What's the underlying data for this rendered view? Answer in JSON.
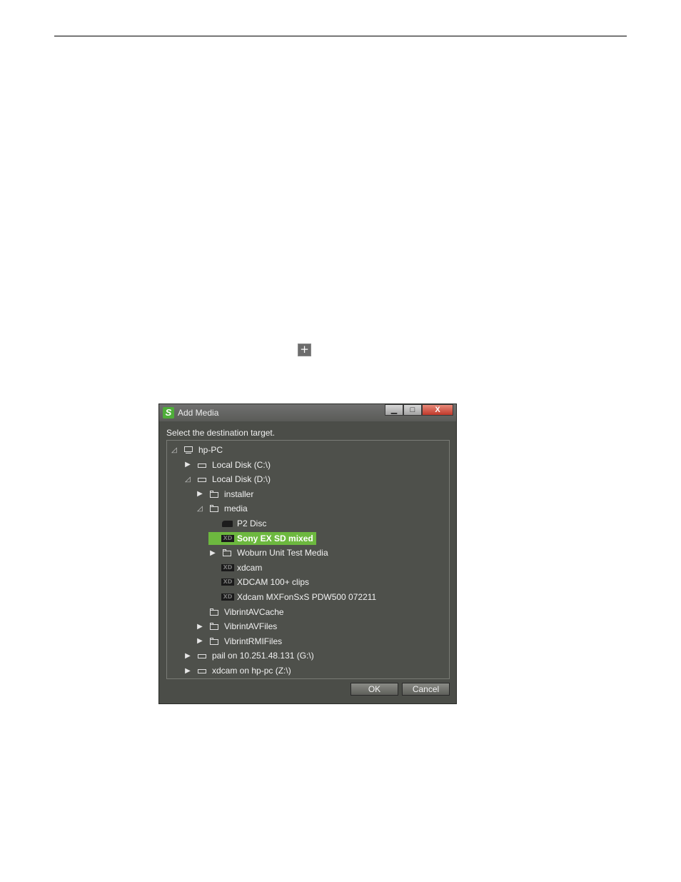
{
  "page": {
    "plus_icon": "+"
  },
  "dialog": {
    "title": "Add Media",
    "app_icon": "S",
    "window_buttons": {
      "minimize": "▁",
      "maximize": "□",
      "close": "X"
    },
    "instruction": "Select the destination target.",
    "tree": [
      {
        "label": "hp-PC",
        "icon": "computer-icon",
        "expander": "◿",
        "level": 0
      },
      {
        "label": "Local Disk (C:\\)",
        "icon": "drive-icon",
        "expander": "▶",
        "level": 1
      },
      {
        "label": "Local Disk (D:\\)",
        "icon": "drive-icon",
        "expander": "◿",
        "level": 1
      },
      {
        "label": "installer",
        "icon": "folder-icon",
        "expander": "▶",
        "level": 2
      },
      {
        "label": "media",
        "icon": "folder-icon",
        "expander": "◿",
        "level": 2
      },
      {
        "label": "P2 Disc",
        "icon": "p2-icon",
        "expander": "",
        "level": 3
      },
      {
        "label": "Sony EX SD mixed",
        "icon": "xd-icon",
        "expander": "",
        "level": 3,
        "selected": true
      },
      {
        "label": "Woburn Unit Test Media",
        "icon": "folder-icon",
        "expander": "▶",
        "level": 3
      },
      {
        "label": "xdcam",
        "icon": "xd-icon",
        "expander": "",
        "level": 3
      },
      {
        "label": "XDCAM 100+ clips",
        "icon": "xd-icon",
        "expander": "",
        "level": 3
      },
      {
        "label": "Xdcam MXFonSxS PDW500 072211",
        "icon": "xd-icon",
        "expander": "",
        "level": 3
      },
      {
        "label": "VibrintAVCache",
        "icon": "folder-icon",
        "expander": "",
        "level": 2
      },
      {
        "label": "VibrintAVFiles",
        "icon": "folder-icon",
        "expander": "▶",
        "level": 2
      },
      {
        "label": "VibrintRMIFiles",
        "icon": "folder-icon",
        "expander": "▶",
        "level": 2
      },
      {
        "label": "pail on 10.251.48.131 (G:\\)",
        "icon": "drive-icon",
        "expander": "▶",
        "level": 1
      },
      {
        "label": "xdcam on hp-pc (Z:\\)",
        "icon": "drive-icon",
        "expander": "▶",
        "level": 1
      }
    ],
    "ok_label": "OK",
    "cancel_label": "Cancel",
    "xd_icon_text": "XD"
  },
  "colors": {
    "selection": "#6db83f",
    "window_bg": "#4b4d48"
  }
}
